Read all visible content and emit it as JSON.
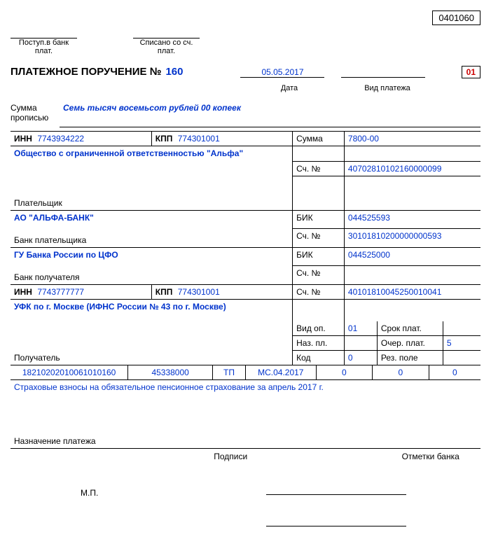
{
  "form_code": "0401060",
  "header": {
    "received_label": "Поступ.в банк плат.",
    "written_off_label": "Списано со сч. плат."
  },
  "title": {
    "doc_title": "ПЛАТЕЖНОЕ ПОРУЧЕНИЕ №",
    "doc_number": "160",
    "date": "05.05.2017",
    "date_label": "Дата",
    "payment_type_label": "Вид платежа",
    "status_code": "01"
  },
  "amount_words": {
    "label1": "Сумма",
    "label2": "прописью",
    "value": "Семь тысяч восемьсот рублей 00 копеек"
  },
  "payer": {
    "inn_label": "ИНН",
    "inn": "7743934222",
    "kpp_label": "КПП",
    "kpp": "774301001",
    "sum_label": "Сумма",
    "sum": "7800-00",
    "name": "Общество с ограниченной ответственностью \"Альфа\"",
    "account_label": "Сч. №",
    "account": "40702810102160000099",
    "payer_label": "Плательщик"
  },
  "payer_bank": {
    "name": "АО \"АЛЬФА-БАНК\"",
    "bik_label": "БИК",
    "bik": "044525593",
    "account_label": "Сч. №",
    "account": "30101810200000000593",
    "bank_label": "Банк плательщика"
  },
  "recipient_bank": {
    "name": "ГУ Банка России по ЦФО",
    "bik_label": "БИК",
    "bik": "044525000",
    "account_label": "Сч. №",
    "bank_label": "Банк получателя"
  },
  "recipient": {
    "inn_label": "ИНН",
    "inn": "7743777777",
    "kpp_label": "КПП",
    "kpp": "774301001",
    "account_label": "Сч. №",
    "account": "40101810045250010041",
    "name": "УФК по г. Москве (ИФНС России № 43 по г. Москве)",
    "recipient_label": "Получатель"
  },
  "ops": {
    "op_type_label": "Вид оп.",
    "op_type": "01",
    "term_label": "Срок плат.",
    "purpose_code_label": "Наз. пл.",
    "priority_label": "Очер. плат.",
    "priority": "5",
    "code_label": "Код",
    "code": "0",
    "reserve_label": "Рез. поле"
  },
  "codes_row": {
    "kbk": "18210202010061010160",
    "oktmo": "45338000",
    "basis": "ТП",
    "period": "МС.04.2017",
    "doc_num": "0",
    "doc_date": "0",
    "type": "0"
  },
  "purpose": {
    "text": "Страховые взносы на обязательное пенсионное страхование за апрель 2017 г.",
    "label": "Назначение платежа"
  },
  "footer": {
    "signatures_label": "Подписи",
    "bank_marks_label": "Отметки банка",
    "mp_label": "М.П."
  }
}
